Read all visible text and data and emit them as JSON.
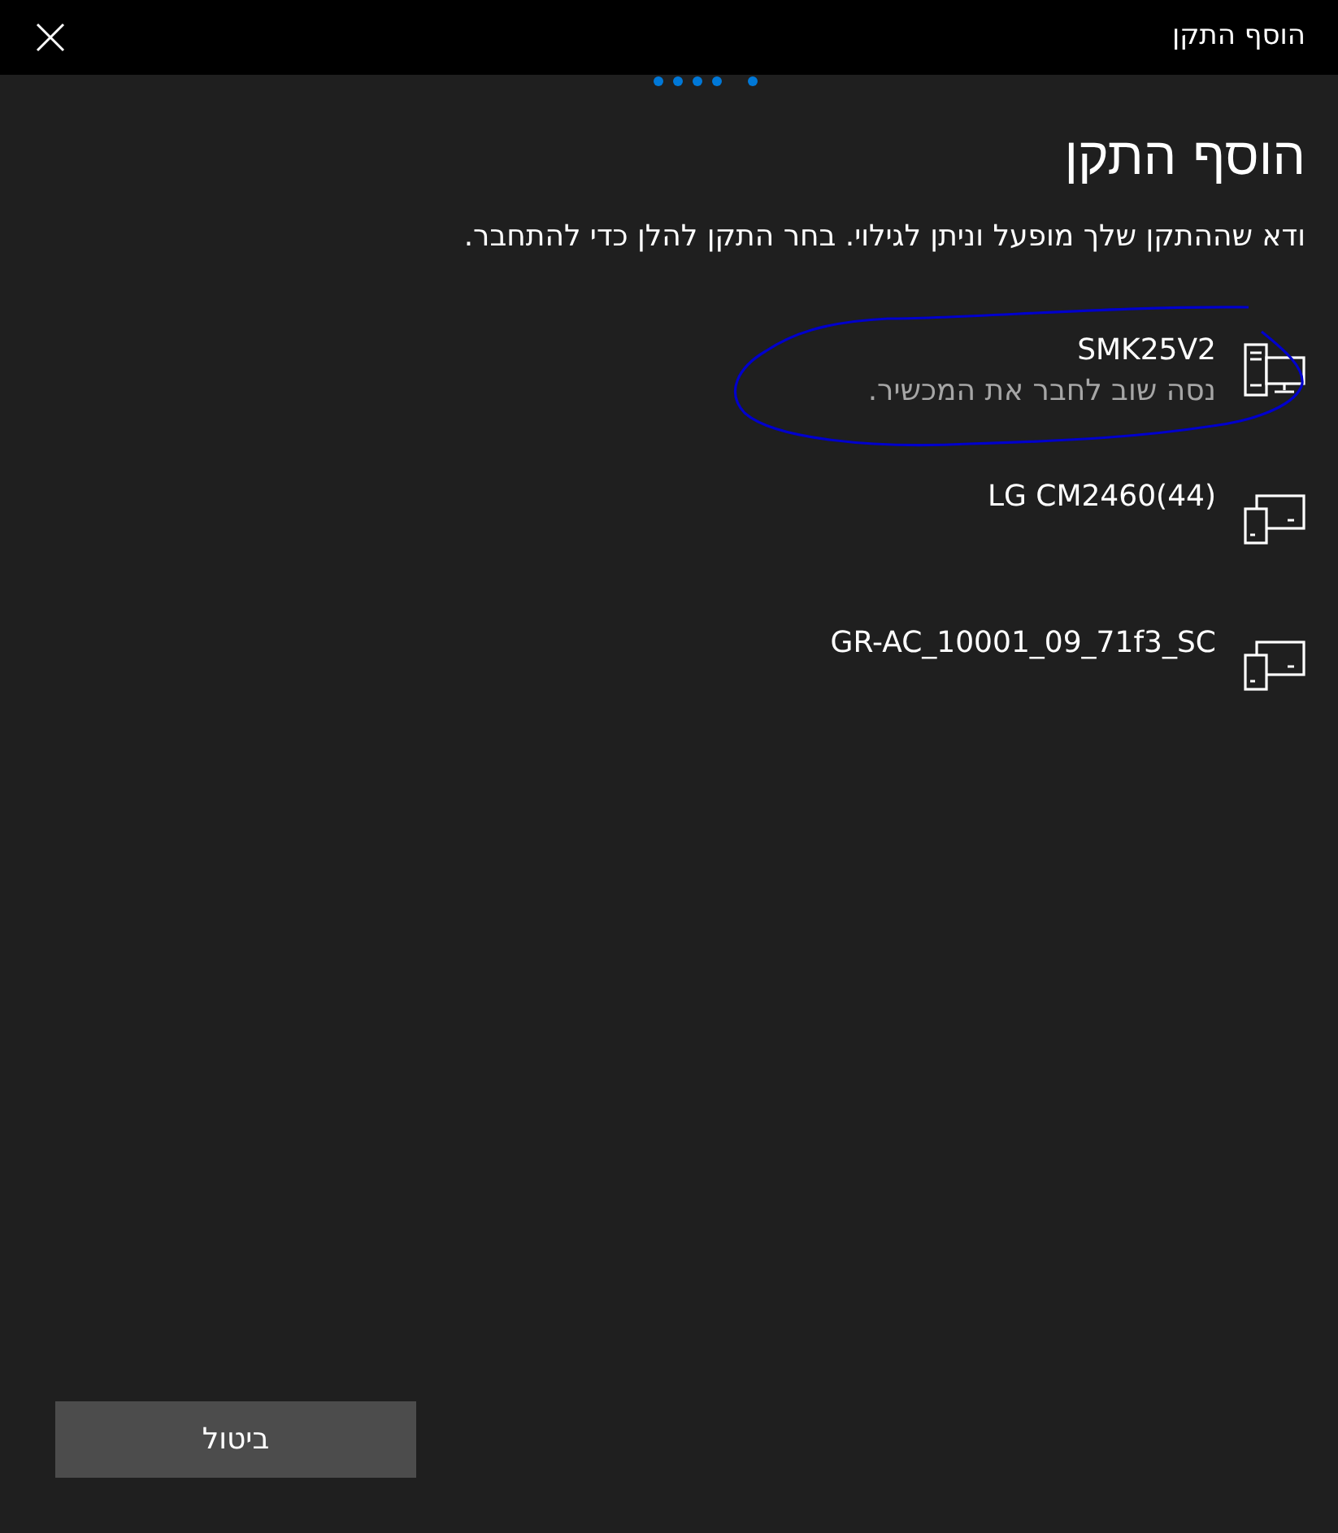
{
  "window": {
    "title": "הוסף התקן"
  },
  "heading": "הוסף התקן",
  "instructions": "ודא שההתקן שלך מופעל וניתן לגילוי. בחר התקן להלן כדי להתחבר.",
  "devices": [
    {
      "name": "SMK25V2",
      "status": "נסה שוב לחבר את המכשיר.",
      "kind": "computer"
    },
    {
      "name": "LG CM2460(44)",
      "kind": "display"
    },
    {
      "name": "GR-AC_10001_09_71f3_SC",
      "kind": "display"
    }
  ],
  "buttons": [
    "ביטול"
  ]
}
